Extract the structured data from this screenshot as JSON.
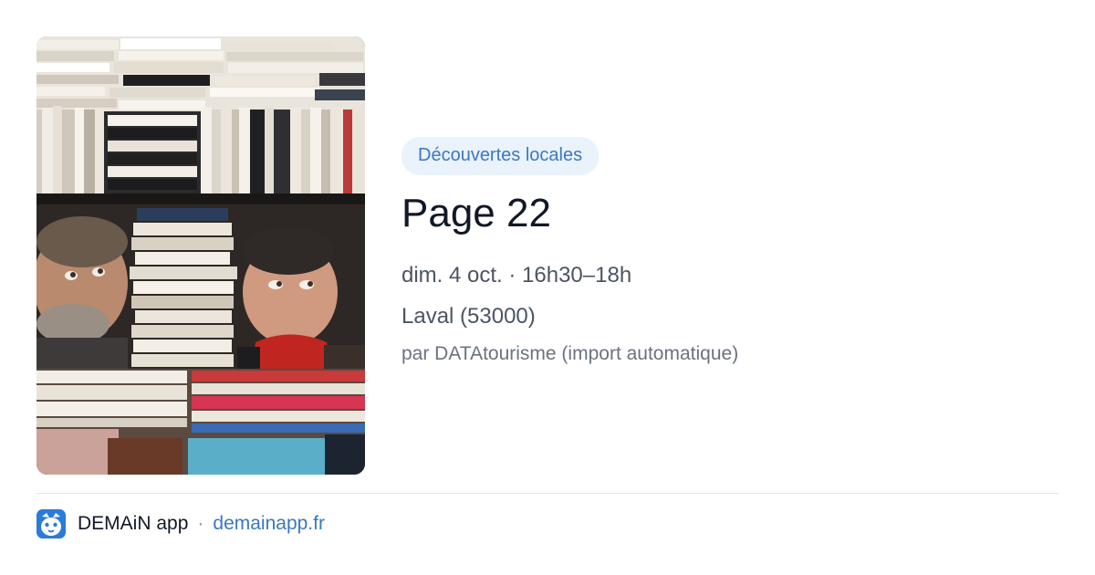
{
  "event": {
    "image_alt": "",
    "category": "Découvertes locales",
    "title": "Page 22",
    "datetime": "dim. 4 oct. · 16h30–18h",
    "location": "Laval (53000)",
    "author": "par DATAtourisme (import automatique)"
  },
  "footer": {
    "app_logo_icon": "demain-app-logo-icon",
    "app_name": "DEMAiN app",
    "separator": "·",
    "link": "demainapp.fr"
  },
  "colors": {
    "badge_bg": "#eaf2fb",
    "accent": "#3a78c2",
    "title": "#111827",
    "meta": "#4b5563",
    "logo": "#2b7bd8"
  }
}
